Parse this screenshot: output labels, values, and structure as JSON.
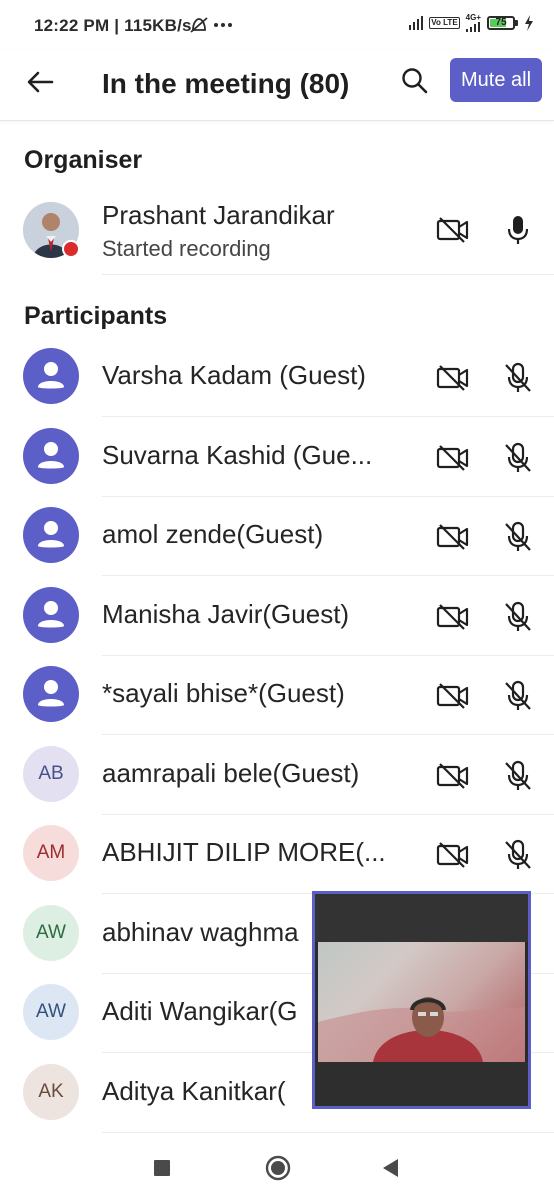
{
  "status_bar": {
    "time_speed": "12:22 PM | 115KB/s",
    "net_type": "4G+",
    "volte": "Vo LTE",
    "battery": "75",
    "battery_level_percent": 75
  },
  "header": {
    "title": "In the meeting (80)",
    "mute_all_label": "Mute all"
  },
  "organiser_section": {
    "title": "Organiser",
    "name": "Prashant Jarandikar",
    "status": "Started recording"
  },
  "participants_section": {
    "title": "Participants",
    "items": [
      {
        "name": "Varsha Kadam (Guest)",
        "avatar": "person-icon"
      },
      {
        "name": "Suvarna Kashid (Gue...",
        "avatar": "person-icon"
      },
      {
        "name": "amol zende(Guest)",
        "avatar": "person-icon"
      },
      {
        "name": "Manisha Javir(Guest)",
        "avatar": "person-icon"
      },
      {
        "name": "*sayali bhise*(Guest)",
        "avatar": "person-icon"
      },
      {
        "name": "aamrapali bele(Guest)",
        "initials": "AB",
        "bg": "#e3e1f1",
        "fg": "#4a4f8a"
      },
      {
        "name": "ABHIJIT DILIP MORE(...",
        "initials": "AM",
        "bg": "#f7dcdc",
        "fg": "#9b2d2d"
      },
      {
        "name": "abhinav waghma",
        "initials": "AW",
        "bg": "#dcefe2",
        "fg": "#2e6b41"
      },
      {
        "name": "Aditi Wangikar(G",
        "initials": "AW",
        "bg": "#dde6f3",
        "fg": "#31527e"
      },
      {
        "name": "Aditya Kanitkar(",
        "initials": "AK",
        "bg": "#ede3df",
        "fg": "#6a4a3d"
      }
    ]
  },
  "colors": {
    "accent": "#5b5fc7",
    "recording": "#d92c2c"
  }
}
